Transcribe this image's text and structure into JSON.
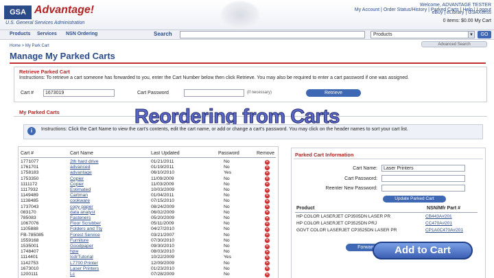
{
  "header": {
    "logo_text": "GSA",
    "brand": "Advantage!",
    "tagline": "U.S. General Services Administration",
    "top_links": "My Account | Order Status/History | Parked Carts | Help | Logout",
    "user_greeting": "Welcome, ADVANTAGE TESTER",
    "sub_links": "eBuy | eLibrary | GSAXcess",
    "cart_status": "0 items: $0.00   My Cart"
  },
  "nav": {
    "products": "Products",
    "services": "Services",
    "nsn": "NSN Ordering",
    "search_label": "Search",
    "search_scope": "Products",
    "go_label": "GO",
    "advanced_search": "Advanced Search"
  },
  "breadcrumb": "Home > My Park Cart",
  "page_title": "Manage My Parked Carts",
  "retrieve": {
    "title": "Retrieve Parked Cart",
    "instructions": "Instructions: To retrieve a cart someone has forwarded to you, enter the Cart Number below then click Retrieve. You may also be required to enter a cart password if one was assigned.",
    "cart_no_label": "Cart #",
    "cart_no_value": "1673019",
    "cart_pw_label": "Cart Password",
    "optional": "(if necessary)",
    "retrieve_btn": "Retrieve"
  },
  "my_parked": {
    "title": "My Parked Carts",
    "overlay_title": "Reordering from Carts",
    "instructions": "Instructions: Click the Cart Name to view the cart's contents, edit the cart name, or add or change a cart's password. You may click on the header names to sort your cart list."
  },
  "table": {
    "headers": [
      "Cart #",
      "Cart Name",
      "Last Updated",
      "Password",
      "Remove"
    ],
    "rows": [
      [
        "1771077",
        "2th hard drive",
        "01/21/2011",
        "No"
      ],
      [
        "1761701",
        "advanced",
        "01/19/2011",
        "No"
      ],
      [
        "1758183",
        "advantage",
        "06/10/2010",
        "Yes"
      ],
      [
        "1753350",
        "Copier",
        "11/09/2009",
        "No"
      ],
      [
        "1111172",
        "Copier",
        "11/03/2009",
        "No"
      ],
      [
        "1117932",
        "Estimated",
        "10/03/2009",
        "No"
      ],
      [
        "1149489",
        "Cartman",
        "01/04/2011",
        "No"
      ],
      [
        "1138485",
        "cookware",
        "07/15/2010",
        "No"
      ],
      [
        "1737043",
        "copy paper",
        "08/24/2009",
        "No"
      ],
      [
        "083170",
        "data analyst",
        "06/02/2009",
        "No"
      ],
      [
        "785083",
        "Fasteners",
        "05/20/2009",
        "No"
      ],
      [
        "1067076",
        "Floor Scrubber",
        "05/11/2009",
        "No"
      ],
      [
        "1105888",
        "Folders and Tty",
        "04/27/2010",
        "No"
      ],
      [
        "FB-785085",
        "Forest Service",
        "03/21/2007",
        "No"
      ],
      [
        "1559168",
        "Furniture",
        "07/30/2010",
        "No"
      ],
      [
        "1535001",
        "Goodpaper",
        "09/30/2010",
        "No"
      ],
      [
        "1748407",
        "hpw",
        "08/03/2010",
        "No"
      ],
      [
        "1114401",
        "IcdrTutorial",
        "10/22/2009",
        "Yes"
      ],
      [
        "1142753",
        "L7700 Printer",
        "12/09/2009",
        "No"
      ],
      [
        "1673010",
        "Laser Printers",
        "01/23/2010",
        "No"
      ],
      [
        "1200111",
        "Lc",
        "07/28/2009",
        "No"
      ]
    ]
  },
  "pci": {
    "title": "Parked Cart Information",
    "cart_name_label": "Cart Name:",
    "cart_name_value": "Laser Printers",
    "cart_pw_label": "Cart Password:",
    "reenter_label": "Reenter New Password:",
    "update_btn": "Update Parked Cart",
    "product_hdr": "Product",
    "nsn_hdr": "NSN/Mfr Part #",
    "products": [
      [
        "HP COLOR LASERJET CP3505DN LASER PR",
        "CB443A#201"
      ],
      [
        "HP COLOR LASERJET CP3525DN PRJ",
        "CC470A#201"
      ],
      [
        "GOVT COLOR LASERJET CP3525DN LASER PR",
        "CP1A0C470A#201"
      ]
    ],
    "forward_btn": "Forward",
    "add_to_cart_btn": "Add to Cart"
  }
}
